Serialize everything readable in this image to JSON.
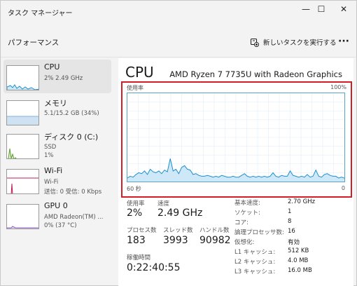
{
  "window": {
    "title": "タスク マネージャー",
    "minimize": "—",
    "maximize": "☐",
    "close": "✕"
  },
  "header": {
    "title": "パフォーマンス",
    "run_task_label": "新しいタスクを実行する",
    "more": "···"
  },
  "sidebar": {
    "items": [
      {
        "name": "CPU",
        "sub1": "2% 2.49 GHz",
        "sub2": "",
        "selected": true
      },
      {
        "name": "メモリ",
        "sub1": "5.1/15.2 GB (34%)",
        "sub2": ""
      },
      {
        "name": "ディスク 0 (C:)",
        "sub1": "SSD",
        "sub2": "1%"
      },
      {
        "name": "Wi-Fi",
        "sub1": "Wi-Fi",
        "sub2": "送信: 0 受信: 0 Kbps"
      },
      {
        "name": "GPU 0",
        "sub1": "AMD Radeon(TM) ...",
        "sub2": "0% (37 °C)"
      }
    ]
  },
  "main": {
    "title": "CPU",
    "model": "AMD Ryzen 7 7735U with Radeon Graphics",
    "graph": {
      "top_left_label": "使用率",
      "top_right_label": "100%",
      "bottom_left_label": "60 秒",
      "bottom_right_label": "0"
    },
    "stats": {
      "usage_label": "使用率",
      "usage_value": "2%",
      "speed_label": "速度",
      "speed_value": "2.49 GHz",
      "processes_label": "プロセス数",
      "processes_value": "183",
      "threads_label": "スレッド数",
      "threads_value": "3993",
      "handles_label": "ハンドル数",
      "handles_value": "90982",
      "uptime_label": "稼働時間",
      "uptime_value": "0:22:40:55"
    },
    "specs": [
      {
        "label": "基本速度:",
        "value": "2.70 GHz"
      },
      {
        "label": "ソケット:",
        "value": "1"
      },
      {
        "label": "コア:",
        "value": "8"
      },
      {
        "label": "論理プロセッサ数:",
        "value": "16"
      },
      {
        "label": "仮想化:",
        "value": "有効"
      },
      {
        "label": "L1 キャッシュ:",
        "value": "512 KB"
      },
      {
        "label": "L2 キャッシュ:",
        "value": "4.0 MB"
      },
      {
        "label": "L3 キャッシュ:",
        "value": "16.0 MB"
      }
    ]
  },
  "colors": {
    "cpu_line": "#1b8fd1",
    "cpu_fill": "#cfe8f7",
    "memory": "#7fb2de",
    "disk": "#5f9e2f",
    "wifi": "#c2185b",
    "gpu": "#8b5fbf",
    "highlight": "#d21f26"
  },
  "chart_data": {
    "type": "area",
    "series": [
      {
        "values": [
          4,
          6,
          5,
          8,
          10,
          9,
          12,
          8,
          14,
          11,
          10,
          12,
          9,
          13,
          11,
          26,
          12,
          14,
          9,
          16,
          18,
          14,
          13,
          8,
          9,
          7,
          6,
          6,
          7,
          6,
          5,
          6,
          5,
          7,
          6,
          5,
          5,
          6,
          5,
          5,
          7,
          9,
          6,
          5,
          6,
          5,
          6,
          5,
          6,
          5,
          6,
          10,
          6,
          5,
          7,
          6,
          6,
          12,
          7,
          6,
          5,
          6,
          5,
          8,
          5,
          6,
          13,
          6,
          5,
          8,
          9,
          7,
          6,
          6,
          4,
          5,
          4
        ]
      }
    ],
    "ylim": [
      0,
      100
    ]
  }
}
